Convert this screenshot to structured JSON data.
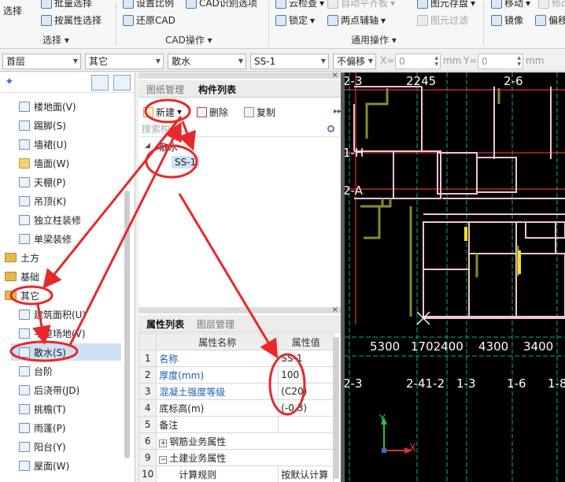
{
  "ribbon": {
    "select_big": "选择",
    "batch_select": "批量选择",
    "prop_select": "按属性选择",
    "group_select": "选择",
    "set_scale": "设置比例",
    "cad_identify": "CAD识别选项",
    "restore_cad": "还原CAD",
    "group_cad": "CAD操作",
    "cloud_check": "云检查",
    "auto_level": "自动平齐板",
    "save_element": "图元存盘",
    "lock": "锁定",
    "two_point_aux": "两点辅轴",
    "element_filter": "图元过滤",
    "group_general": "通用操作",
    "move": "移动",
    "modify": "修改",
    "mirror": "镜像",
    "offset": "偏移"
  },
  "toolbar": {
    "floor": "首层",
    "category": "其它",
    "type": "散水",
    "element": "SS-1",
    "offset_mode": "不偏移",
    "x_label": "X=",
    "x_value": "0",
    "mm1": "mm",
    "y_label": "Y=",
    "y_value": "0",
    "mm2": "mm"
  },
  "tree": {
    "items": [
      {
        "label": "楼地面(V)"
      },
      {
        "label": "踢脚(S)"
      },
      {
        "label": "墙裙(U)"
      },
      {
        "label": "墙面(W)"
      },
      {
        "label": "天棚(P)"
      },
      {
        "label": "吊顶(K)"
      },
      {
        "label": "独立柱装修"
      },
      {
        "label": "单梁装修"
      },
      {
        "label": "土方"
      },
      {
        "label": "基础"
      },
      {
        "label": "其它"
      },
      {
        "label": "建筑面积(U)"
      },
      {
        "label": "平整场地(V)"
      },
      {
        "label": "散水(S)"
      },
      {
        "label": "台阶"
      },
      {
        "label": "后浇带(JD)"
      },
      {
        "label": "挑檐(T)"
      },
      {
        "label": "雨蓬(P)"
      },
      {
        "label": "阳台(Y)"
      },
      {
        "label": "屋面(W)"
      }
    ]
  },
  "component_panel": {
    "tab_drawing": "图纸管理",
    "tab_list": "构件列表",
    "new_btn": "新建",
    "delete_btn": "删除",
    "copy_btn": "复制",
    "search_placeholder": "搜索构件...",
    "group": "散水",
    "item": "SS-1"
  },
  "property_panel": {
    "tab_props": "属性列表",
    "tab_layers": "图层管理",
    "col_name": "属性名称",
    "col_value": "属性值",
    "rows": [
      {
        "n": "1",
        "name": "名称",
        "value": "SS-1"
      },
      {
        "n": "2",
        "name": "厚度(mm)",
        "value": "100"
      },
      {
        "n": "3",
        "name": "混凝土强度等级",
        "value": "(C20)"
      },
      {
        "n": "4",
        "name": "底标高(m)",
        "value": "(-0.3)"
      },
      {
        "n": "5",
        "name": "备注",
        "value": ""
      },
      {
        "n": "6",
        "name": "钢筋业务属性",
        "value": ""
      },
      {
        "n": "9",
        "name": "土建业务属性",
        "value": ""
      },
      {
        "n": "10",
        "name": "计算规则",
        "value": "按默认计算"
      }
    ]
  },
  "cad": {
    "top_axes": [
      "2-3",
      "2245",
      "2-6"
    ],
    "side_axes": [
      "1-H",
      "2-A"
    ],
    "dims": [
      "5300",
      "1702400",
      "4300",
      "3400"
    ],
    "bottom_axes": [
      "2-3",
      "2-41-2",
      "1-3",
      "1-6",
      "1-8"
    ],
    "ucs_y": "Y",
    "ucs_x": "X"
  },
  "colors": {
    "accent": "#1a5fb4",
    "annotation": "#e8282b",
    "selection": "#cfe1f6"
  }
}
